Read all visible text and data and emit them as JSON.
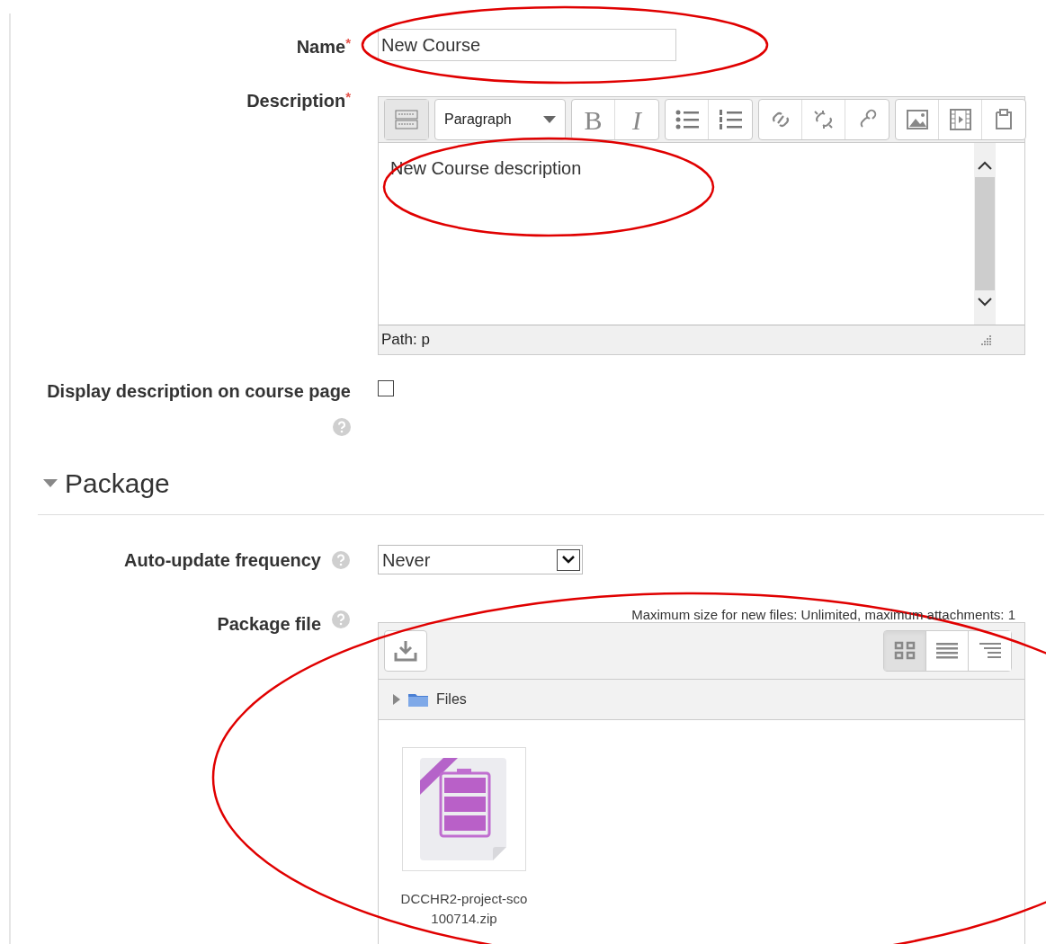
{
  "name_field": {
    "label": "Name",
    "required_mark": "*",
    "value": "New Course"
  },
  "description_field": {
    "label": "Description",
    "required_mark": "*",
    "format": "Paragraph",
    "bold_glyph": "B",
    "italic_glyph": "I",
    "content": "New Course description",
    "path": "Path: p"
  },
  "display_description": {
    "label": "Display description on course page",
    "checked": false
  },
  "section": {
    "title": "Package",
    "expanded": true
  },
  "auto_update": {
    "label": "Auto-update frequency",
    "value": "Never"
  },
  "package_file": {
    "label": "Package file",
    "limits": "Maximum size for new files: Unlimited, maximum attachments: 1",
    "folder": "Files",
    "view_modes": [
      {
        "kind": "icons",
        "selected": true
      },
      {
        "kind": "list",
        "selected": false
      },
      {
        "kind": "tree",
        "selected": false
      }
    ],
    "files": [
      {
        "name": "DCCHR2-project-sco 100714.zip"
      }
    ]
  }
}
